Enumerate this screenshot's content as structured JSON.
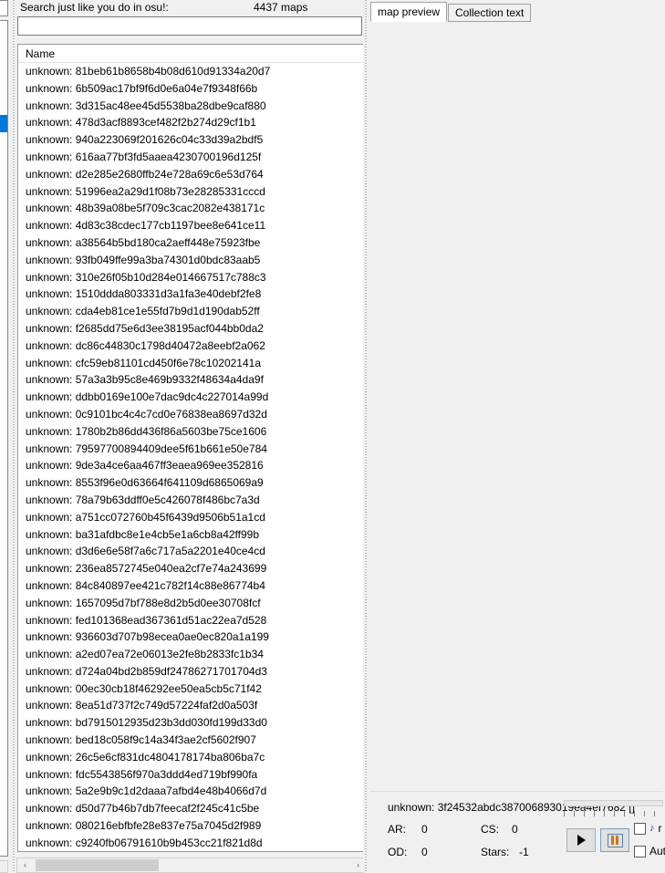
{
  "app": {
    "accent": "#0078d7",
    "list_bg": "#ffffff",
    "panel_bg": "#f0f0f0"
  },
  "search": {
    "label": "Search just like you do in osu!:",
    "value": "",
    "placeholder": "",
    "maps_count": "4437 maps"
  },
  "list": {
    "column_header": "Name",
    "rows": [
      "unknown: 81beb61b8658b4b08d610d91334a20d7",
      "unknown: 6b509ac17bf9f6d0e6a04e7f9348f66b",
      "unknown: 3d315ac48ee45d5538ba28dbe9caf880",
      "unknown: 478d3acf8893cef482f2b274d29cf1b1",
      "unknown: 940a223069f201626c04c33d39a2bdf5",
      "unknown: 616aa77bf3fd5aaea4230700196d125f",
      "unknown: d2e285e2680ffb24e728a69c6e53d764",
      "unknown: 51996ea2a29d1f08b73e28285331cccd",
      "unknown: 48b39a08be5f709c3cac2082e438171c",
      "unknown: 4d83c38cdec177cb1197bee8e641ce11",
      "unknown: a38564b5bd180ca2aeff448e75923fbe",
      "unknown: 93fb049ffe99a3ba74301d0bdc83aab5",
      "unknown: 310e26f05b10d284e014667517c788c3",
      "unknown: 1510ddda803331d3a1fa3e40debf2fe8",
      "unknown: cda4eb81ce1e55fd7b9d1d190dab52ff",
      "unknown: f2685dd75e6d3ee38195acf044bb0da2",
      "unknown: dc86c44830c1798d40472a8eebf2a062",
      "unknown: cfc59eb81101cd450f6e78c10202141a",
      "unknown: 57a3a3b95c8e469b9332f48634a4da9f",
      "unknown: ddbb0169e100e7dac9dc4c227014a99d",
      "unknown: 0c9101bc4c4c7cd0e76838ea8697d32d",
      "unknown: 1780b2b86dd436f86a5603be75ce1606",
      "unknown: 79597700894409dee5f61b661e50e784",
      "unknown: 9de3a4ce6aa467ff3eaea969ee352816",
      "unknown: 8553f96e0d63664f641109d6865069a9",
      "unknown: 78a79b63ddff0e5c426078f486bc7a3d",
      "unknown: a751cc072760b45f6439d9506b51a1cd",
      "unknown: ba31afdbc8e1e4cb5e1a6cb8a42ff99b",
      "unknown: d3d6e6e58f7a6c717a5a2201e40ce4cd",
      "unknown: 236ea8572745e040ea2cf7e74a243699",
      "unknown: 84c840897ee421c782f14c88e86774b4",
      "unknown: 1657095d7bf788e8d2b5d0ee30708fcf",
      "unknown: fed101368ead367361d51ac22ea7d528",
      "unknown: 936603d707b98ecea0ae0ec820a1a199",
      "unknown: a2ed07ea72e06013e2fe8b2833fc1b34",
      "unknown: d724a04bd2b859df24786271701704d3",
      "unknown: 00ec30cb18f46292ee50ea5cb5c71f42",
      "unknown: 8ea51d737f2c749d57224faf2d0a503f",
      "unknown: bd7915012935d23b3dd030fd199d33d0",
      "unknown: bed18c058f9c14a34f3ae2cf5602f907",
      "unknown: 26c5e6cf831dc4804178174ba806ba7c",
      "unknown: fdc5543856f970a3ddd4ed719bf990fa",
      "unknown: 5a2e9b9c1d2daaa7afbd4e48b4066d7d",
      "unknown: d50d77b46b7db7feecaf2f245c41c5be",
      "unknown: 080216ebfbfe28e837e75a7045d2f989",
      "unknown: c9240fb06791610b9b453cc21f821d8d"
    ]
  },
  "right": {
    "tabs": [
      {
        "label": "map preview",
        "active": true
      },
      {
        "label": "Collection text",
        "active": false
      }
    ]
  },
  "info": {
    "title": "unknown: 3f24532abdc387006893019ea4ef7682 []",
    "ar_label": "AR:",
    "ar_value": "0",
    "cs_label": "CS:",
    "cs_value": "0",
    "od_label": "OD:",
    "od_value": "0",
    "stars_label": "Stars:",
    "stars_value": "-1",
    "checkbox_music_label": "r",
    "checkbox_auto_label": "Aut"
  },
  "scroll": {
    "up_arrow": "▲",
    "down_arrow": "▼",
    "left_arrow": "‹",
    "right_arrow": "›"
  }
}
